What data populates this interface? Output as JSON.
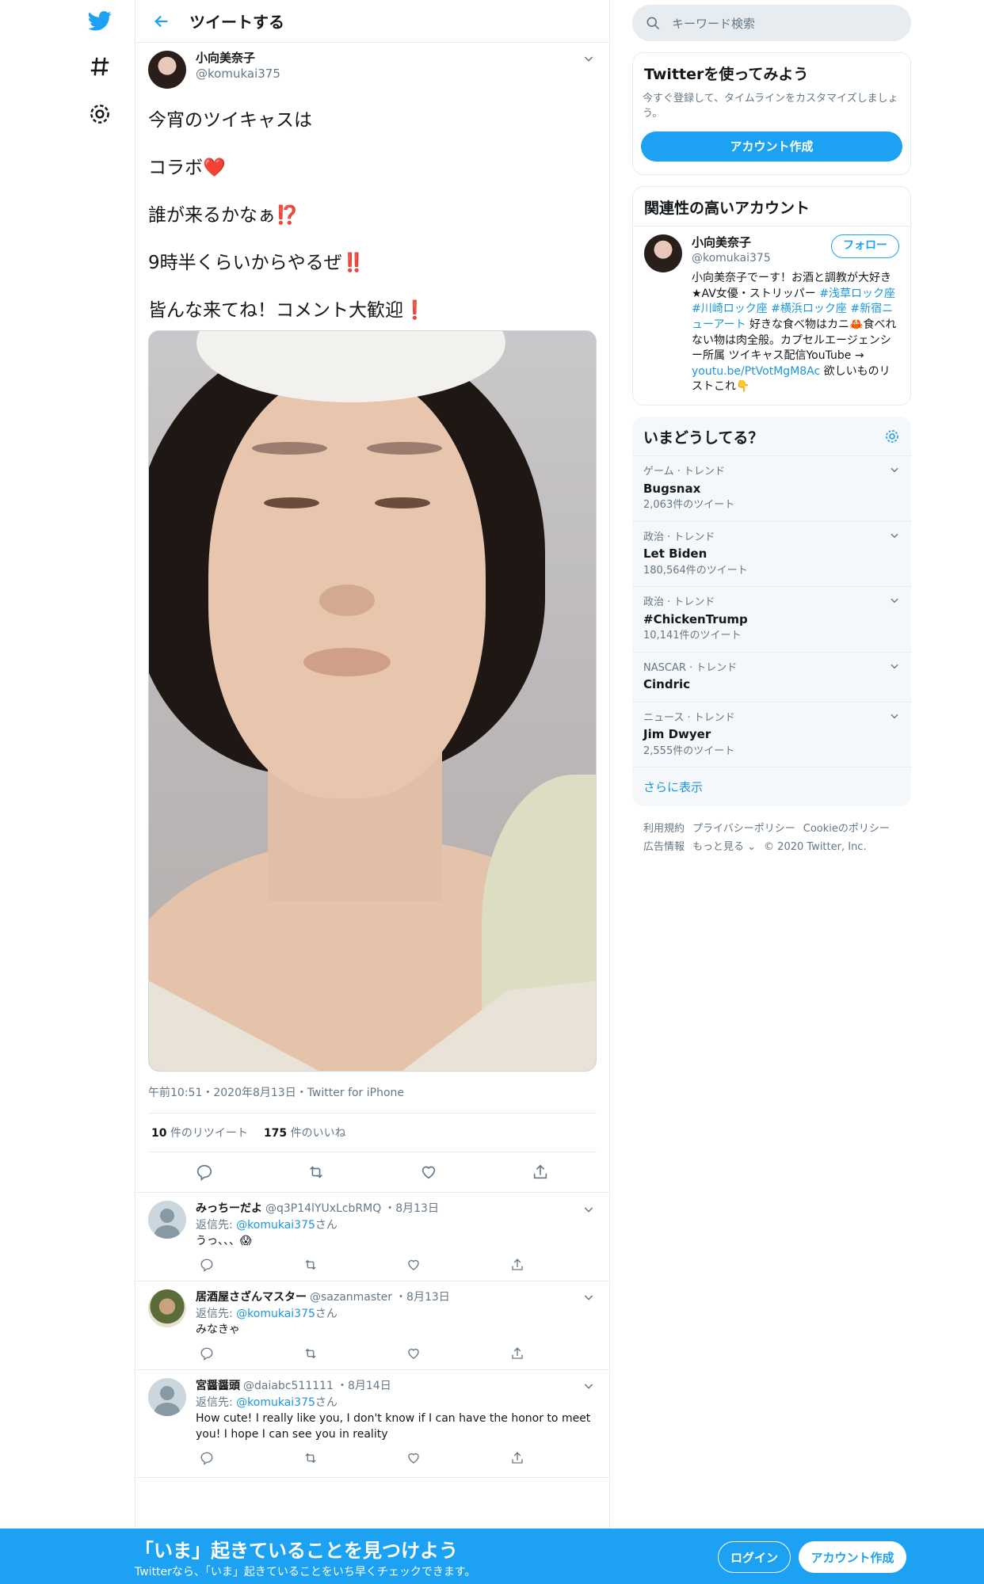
{
  "header": {
    "title": "ツイートする"
  },
  "tweet": {
    "author_name": "小向美奈子",
    "author_handle": "@komukai375",
    "lines": [
      {
        "text": "今宵のツイキャスは",
        "emoji": ""
      },
      {
        "text": "コラボ",
        "emoji": "❤️"
      },
      {
        "text": "誰が来るかなぁ",
        "emoji": "⁉️"
      },
      {
        "text": "9時半くらいからやるぜ",
        "emoji": "‼️"
      },
      {
        "text": "皆んな来てね！コメント大歓迎",
        "emoji": "❗"
      }
    ],
    "meta": "午前10:51・2020年8月13日・Twitter for iPhone",
    "retweets": "10",
    "retweets_label": "件のリツイート",
    "likes": "175",
    "likes_label": "件のいいね"
  },
  "replies": [
    {
      "name": "みっちーだよ",
      "handle": "@q3P14lYUxLcbRMQ",
      "date": "・8月13日",
      "to_label": "返信先:",
      "to_handle": "@komukai375",
      "to_suffix": "さん",
      "text": "うっ、、、😱"
    },
    {
      "name": "居酒屋さざんマスター",
      "handle": "@sazanmaster",
      "date": "・8月13日",
      "to_label": "返信先:",
      "to_handle": "@komukai375",
      "to_suffix": "さん",
      "text": "みなきゃ"
    },
    {
      "name": "宮醤醤頭",
      "handle": "@daiabc511111",
      "date": "・8月14日",
      "to_label": "返信先:",
      "to_handle": "@komukai375",
      "to_suffix": "さん",
      "text": "How cute! I really like you, I don't know if I can have the honor to meet you! I hope I can see you in reality"
    }
  ],
  "search": {
    "placeholder": "キーワード検索"
  },
  "signup_card": {
    "title": "Twitterを使ってみよう",
    "desc": "今すぐ登録して、タイムラインをカスタマイズしましょう。",
    "button": "アカウント作成"
  },
  "related": {
    "title": "関連性の高いアカウント",
    "name": "小向美奈子",
    "handle": "@komukai375",
    "follow": "フォロー",
    "bio_1": "小向美奈子でーす！お酒と調教が大好き★AV女優・ストリッパー ",
    "bio_tags": "#浅草ロック座 #川崎ロック座 #横浜ロック座 #新宿ニューアート",
    "bio_2": " 好きな食べ物はカニ🦀食べれない物は肉全般。カプセルエージェンシー所属 ツイキャス配信YouTube → ",
    "bio_link": "youtu.be/PtVotMgM8Ac",
    "bio_3": " 欲しいものリストこれ👇"
  },
  "trends": {
    "title": "いまどうしてる？",
    "items": [
      {
        "category": "ゲーム · トレンド",
        "name": "Bugsnax",
        "count": "2,063件のツイート"
      },
      {
        "category": "政治 · トレンド",
        "name": "Let Biden",
        "count": "180,564件のツイート"
      },
      {
        "category": "政治 · トレンド",
        "name": "#ChickenTrump",
        "count": "10,141件のツイート"
      },
      {
        "category": "NASCAR · トレンド",
        "name": "Cindric",
        "count": ""
      },
      {
        "category": "ニュース · トレンド",
        "name": "Jim Dwyer",
        "count": "2,555件のツイート"
      }
    ],
    "more": "さらに表示"
  },
  "footer": {
    "links": [
      "利用規約",
      "プライバシーポリシー",
      "Cookieのポリシー",
      "広告情報",
      "もっと見る ⌄",
      "© 2020 Twitter, Inc."
    ]
  },
  "bottom_bar": {
    "headline": "「いま」起きていることを見つけよう",
    "sub": "Twitterなら、「いま」起きていることをいち早くチェックできます。",
    "login": "ログイン",
    "signup": "アカウント作成"
  },
  "colors": {
    "accent": "#1da1f2",
    "link": "#1b95e0",
    "muted": "#657786"
  }
}
